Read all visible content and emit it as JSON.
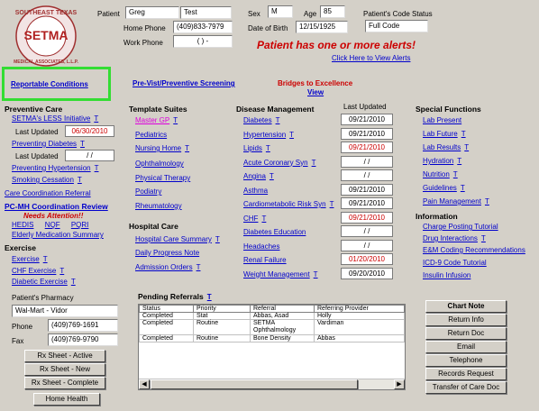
{
  "logo": {
    "top": "SOUTHEAST TEXAS",
    "mid": "SETMA",
    "bottom": "MEDICAL ASSOCIATES, L.L.P."
  },
  "patient": {
    "label": "Patient",
    "first": "Greg",
    "last": "Test",
    "sex_label": "Sex",
    "sex": "M",
    "age_label": "Age",
    "age": "85",
    "code_label": "Patient's Code Status",
    "code": "Full Code",
    "home_phone_label": "Home Phone",
    "home_phone": "(409)833-7979",
    "work_phone_label": "Work Phone",
    "work_phone": "(   )   -",
    "dob_label": "Date of Birth",
    "dob": "12/15/1925"
  },
  "alert": {
    "text": "Patient has one or more alerts!",
    "link": "Click Here to View Alerts"
  },
  "top_links": {
    "reportable": "Reportable Conditions",
    "previsit": "Pre-Vist/Preventive Screening",
    "bridges": "Bridges to Excellence",
    "view": "View"
  },
  "preventive": {
    "title": "Preventive Care",
    "less": "SETMA's LESS Initiative",
    "t": "T",
    "last_updated": "Last Updated",
    "less_date": "06/30/2010",
    "diabetes": "Preventing Diabetes",
    "diabetes_date": " / /",
    "hypertension": "Preventing Hypertension",
    "smoking": "Smoking Cessation",
    "care_coord": "Care Coordination Referral",
    "pcmh": "PC-MH Coordination Review",
    "needs": "Needs Attention!!",
    "hedis": "HEDIS",
    "nqf": "NQF",
    "pqri": "PQRI",
    "elderly": "Elderly Medication Summary"
  },
  "exercise": {
    "title": "Exercise",
    "items": [
      "Exercise",
      "CHF Exercise",
      "Diabetic Exercise"
    ]
  },
  "pharmacy": {
    "label": "Patient's Pharmacy",
    "name": "Wal-Mart - Vidor",
    "phone_label": "Phone",
    "phone": "(409)769-1691",
    "fax_label": "Fax",
    "fax": "(409)769-9790"
  },
  "rx_buttons": [
    "Rx Sheet - Active",
    "Rx Sheet - New",
    "Rx Sheet - Complete",
    "Home Health"
  ],
  "templates": {
    "title": "Template Suites",
    "items": [
      "Master GP",
      "Pediatrics",
      "Nursing Home",
      "Ophthalmology",
      "Physical Therapy",
      "Podiatry",
      "Rheumatology"
    ]
  },
  "hospital": {
    "title": "Hospital Care",
    "items": [
      "Hospital Care Summary",
      "Daily Progress Note",
      "Admission Orders"
    ]
  },
  "disease": {
    "title": "Disease Management",
    "last_updated": "Last Updated",
    "items": [
      {
        "label": "Diabetes",
        "date": "09/21/2010",
        "red": false
      },
      {
        "label": "Hypertension",
        "date": "09/21/2010",
        "red": false
      },
      {
        "label": "Lipids",
        "date": "09/21/2010",
        "red": true
      },
      {
        "label": "Acute Coronary Syn",
        "date": " / /",
        "red": false
      },
      {
        "label": "Angina",
        "date": " / /",
        "red": false
      },
      {
        "label": "Asthma",
        "date": "09/21/2010",
        "red": false
      },
      {
        "label": "Cardiometabolic Risk Syn",
        "date": "09/21/2010",
        "red": false
      },
      {
        "label": "CHF",
        "date": "09/21/2010",
        "red": true
      },
      {
        "label": "Diabetes Education",
        "date": " / /",
        "red": false
      },
      {
        "label": "Headaches",
        "date": " / /",
        "red": false
      },
      {
        "label": "Renal Failure",
        "date": "01/20/2010",
        "red": true
      },
      {
        "label": "Weight Management",
        "date": "09/20/2010",
        "red": false
      }
    ]
  },
  "special": {
    "title": "Special Functions",
    "items": [
      "Lab Present",
      "Lab Future",
      "Lab Results",
      "Hydration",
      "Nutrition",
      "Guidelines",
      "Pain Management"
    ]
  },
  "information": {
    "title": "Information",
    "items": [
      "Charge Posting Tutorial",
      "Drug Interactions",
      "E&M Coding Recommendations",
      "ICD-9 Code Tutorial",
      "Insulin Infusion"
    ]
  },
  "referrals": {
    "title": "Pending Referrals",
    "t": "T",
    "headers": [
      "Status",
      "Priority",
      "Referral",
      "Referring Provider"
    ],
    "rows": [
      [
        "Completed",
        "Stat",
        "Abbas, Asad",
        "Holly"
      ],
      [
        "Completed",
        "Routine",
        "SETMA Ophthalmology",
        "Vardiman"
      ],
      [
        "Completed",
        "Routine",
        "Bone Density",
        "Abbas"
      ]
    ]
  },
  "right_buttons": [
    "Chart Note",
    "Return Info",
    "Return Doc",
    "Email",
    "Telephone",
    "Records Request",
    "Transfer of Care Doc"
  ]
}
